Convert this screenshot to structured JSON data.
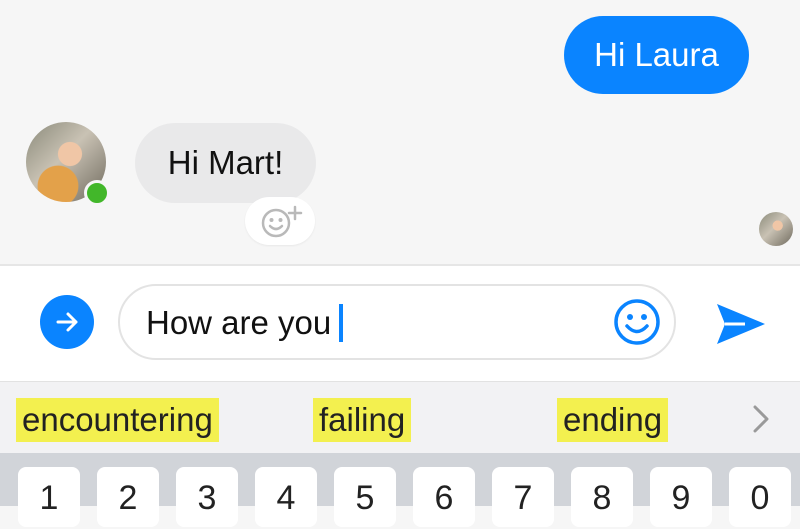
{
  "messages": {
    "outgoing": "Hi Laura",
    "incoming": "Hi Mart!"
  },
  "composer": {
    "input_value": "How are you"
  },
  "suggestions": [
    "encountering",
    "failing",
    "ending"
  ],
  "keyboard": {
    "keys": [
      "1",
      "2",
      "3",
      "4",
      "5",
      "6",
      "7",
      "8",
      "9",
      "0"
    ]
  },
  "colors": {
    "accent": "#0a84ff",
    "online": "#42b72a",
    "highlight": "#f3f04f"
  },
  "icons": {
    "expand": "arrow-right-circle-icon",
    "emoji": "smiley-icon",
    "send": "send-icon",
    "reaction": "add-reaction-icon",
    "more": "chevron-right-icon"
  }
}
